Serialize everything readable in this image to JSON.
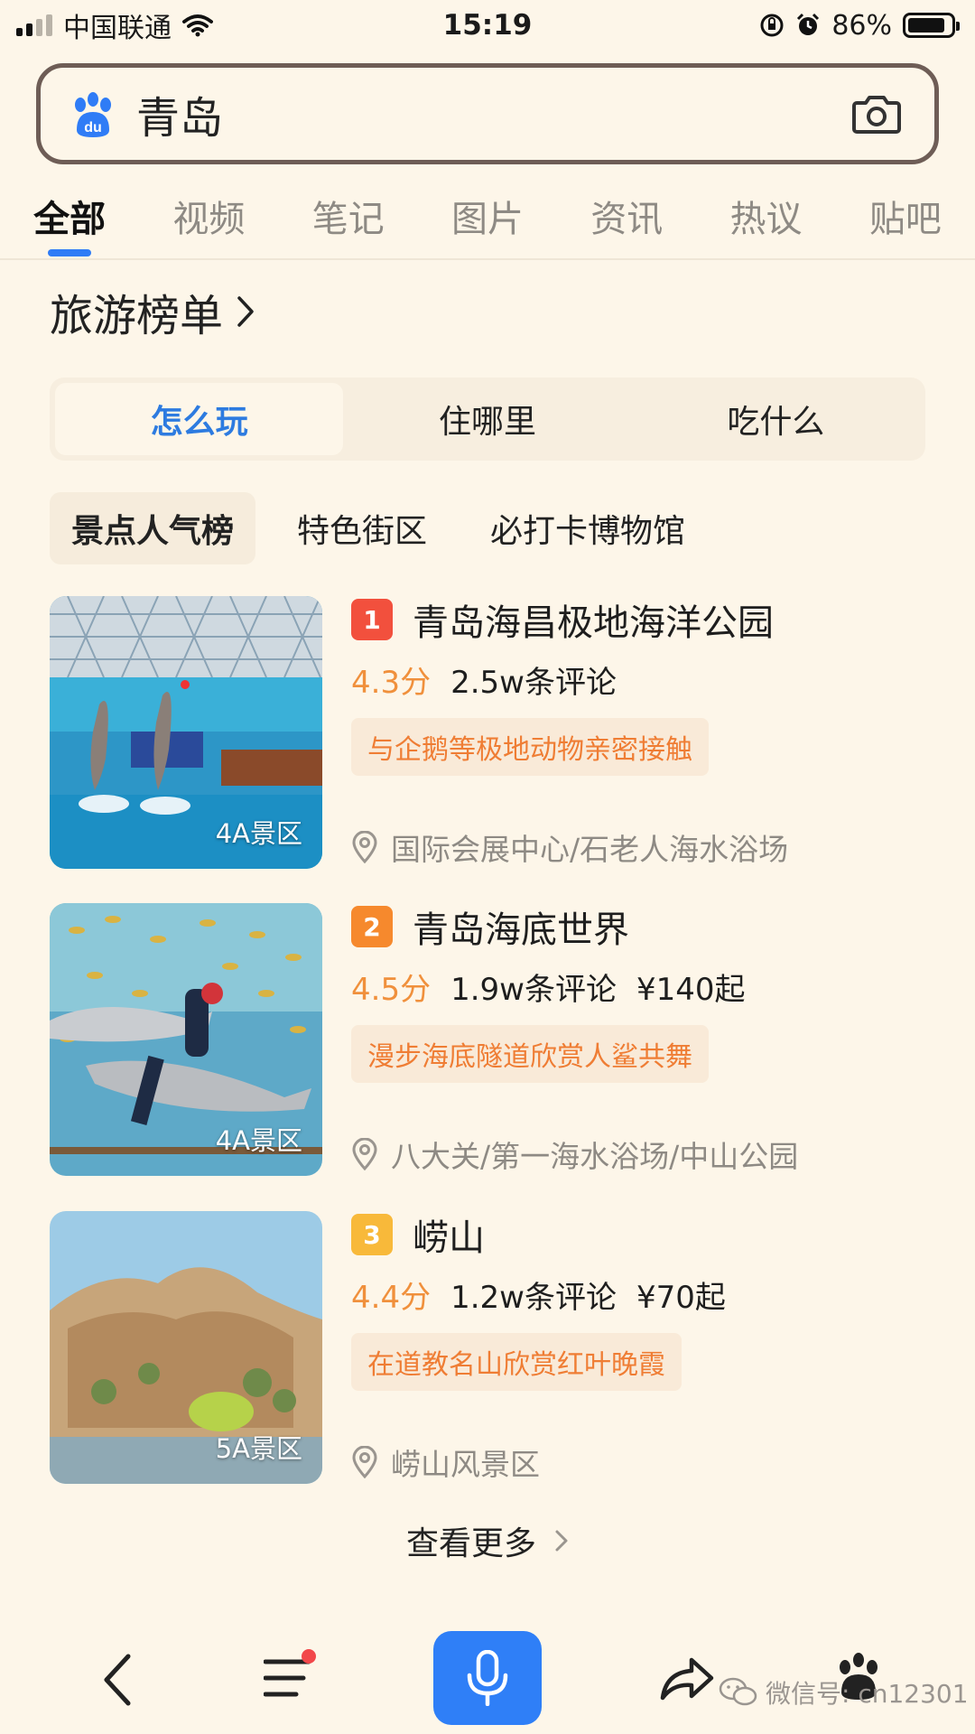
{
  "status_bar": {
    "carrier": "中国联通",
    "time": "15:19",
    "battery_percent": "86%",
    "battery_level": 0.86,
    "signal_bars": 2
  },
  "search": {
    "query": "青岛",
    "logo_text": "du"
  },
  "tabs": [
    "全部",
    "视频",
    "笔记",
    "图片",
    "资讯",
    "热议",
    "贴吧"
  ],
  "active_tab": 0,
  "section": {
    "title": "旅游榜单"
  },
  "segments": [
    "怎么玩",
    "住哪里",
    "吃什么"
  ],
  "active_segment": 0,
  "chips": [
    "景点人气榜",
    "特色街区",
    "必打卡博物馆"
  ],
  "active_chip": 0,
  "colors": {
    "accent": "#2f7cf6",
    "score": "#f0903c",
    "rank1": "#f2503d",
    "rank2": "#f6892d",
    "rank3": "#f8b93a"
  },
  "items": [
    {
      "rank": "1",
      "name": "青岛海昌极地海洋公园",
      "score": "4.3分",
      "reviews": "2.5w条评论",
      "price": "",
      "tag": "与企鹅等极地动物亲密接触",
      "location": "国际会展中心/石老人海水浴场",
      "level": "4A景区"
    },
    {
      "rank": "2",
      "name": "青岛海底世界",
      "score": "4.5分",
      "reviews": "1.9w条评论",
      "price": "¥140起",
      "tag": "漫步海底隧道欣赏人鲨共舞",
      "location": "八大关/第一海水浴场/中山公园",
      "level": "4A景区"
    },
    {
      "rank": "3",
      "name": "崂山",
      "score": "4.4分",
      "reviews": "1.2w条评论",
      "price": "¥70起",
      "tag": "在道教名山欣赏红叶晚霞",
      "location": "崂山风景区",
      "level": "5A景区"
    }
  ],
  "more_label": "查看更多",
  "watermark": "微信号: cn12301"
}
